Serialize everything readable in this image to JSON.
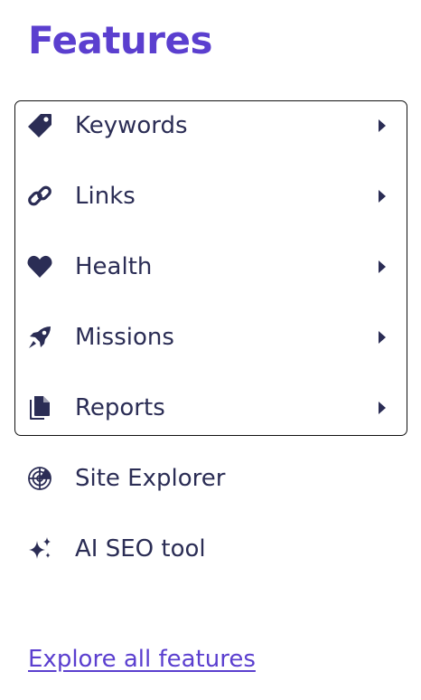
{
  "title": "Features",
  "menu": {
    "items": [
      {
        "label": "Keywords",
        "icon": "tag-icon"
      },
      {
        "label": "Links",
        "icon": "link-icon"
      },
      {
        "label": "Health",
        "icon": "heart-icon"
      },
      {
        "label": "Missions",
        "icon": "rocket-icon"
      },
      {
        "label": "Reports",
        "icon": "document-icon"
      }
    ]
  },
  "extra_items": [
    {
      "label": "Site Explorer",
      "icon": "radar-icon"
    },
    {
      "label": "AI SEO tool",
      "icon": "sparkles-icon"
    }
  ],
  "explore_link": "Explore all features",
  "colors": {
    "accent": "#5b3fcf",
    "text": "#2b2d55",
    "border": "#111111"
  }
}
